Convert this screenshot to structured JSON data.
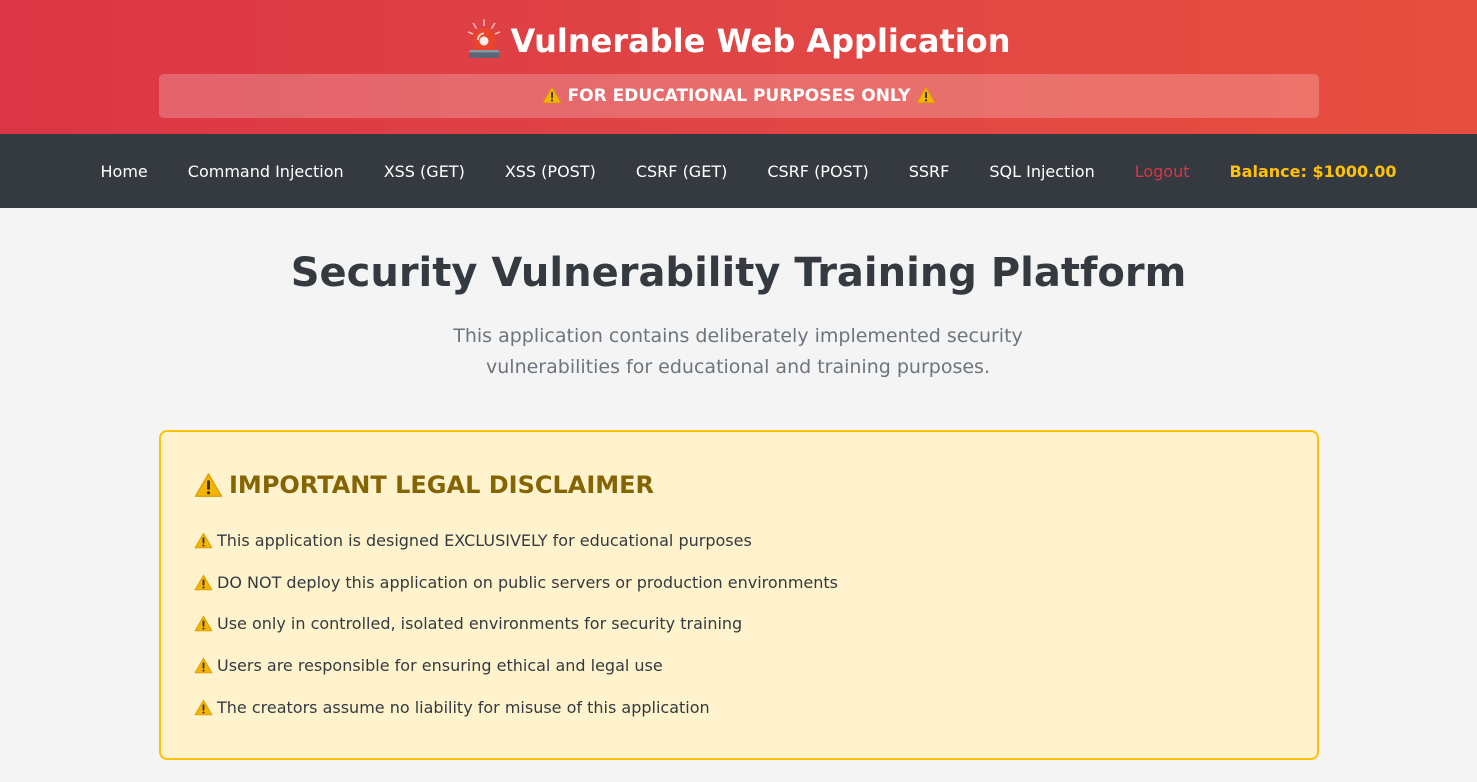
{
  "header": {
    "title": "Vulnerable Web Application",
    "title_icon": "siren-icon",
    "banner_text": "FOR EDUCATIONAL PURPOSES ONLY",
    "banner_icon": "warning-icon",
    "gradient_colors": [
      "#dc3545",
      "#e84e3e"
    ]
  },
  "nav": {
    "items": [
      {
        "label": "Home"
      },
      {
        "label": "Command Injection"
      },
      {
        "label": "XSS (GET)"
      },
      {
        "label": "XSS (POST)"
      },
      {
        "label": "CSRF (GET)"
      },
      {
        "label": "CSRF (POST)"
      },
      {
        "label": "SSRF"
      },
      {
        "label": "SQL Injection"
      }
    ],
    "logout_label": "Logout",
    "balance_text": "Balance: $1000.00",
    "background_color": "#343a40",
    "logout_color": "#dc3545",
    "balance_color": "#ffc107"
  },
  "main": {
    "title": "Security Vulnerability Training Platform",
    "intro": "This application contains deliberately implemented security vulnerabilities for educational and training purposes.",
    "disclaimer": {
      "title": "IMPORTANT LEGAL DISCLAIMER",
      "items": [
        "This application is designed EXCLUSIVELY for educational purposes",
        "DO NOT deploy this application on public servers or production environments",
        "Use only in controlled, isolated environments for security training",
        "Users are responsible for ensuring ethical and legal use",
        "The creators assume no liability for misuse of this application"
      ],
      "background_color": "#fff3cd",
      "border_color": "#ffc107",
      "title_color": "#856404"
    }
  }
}
